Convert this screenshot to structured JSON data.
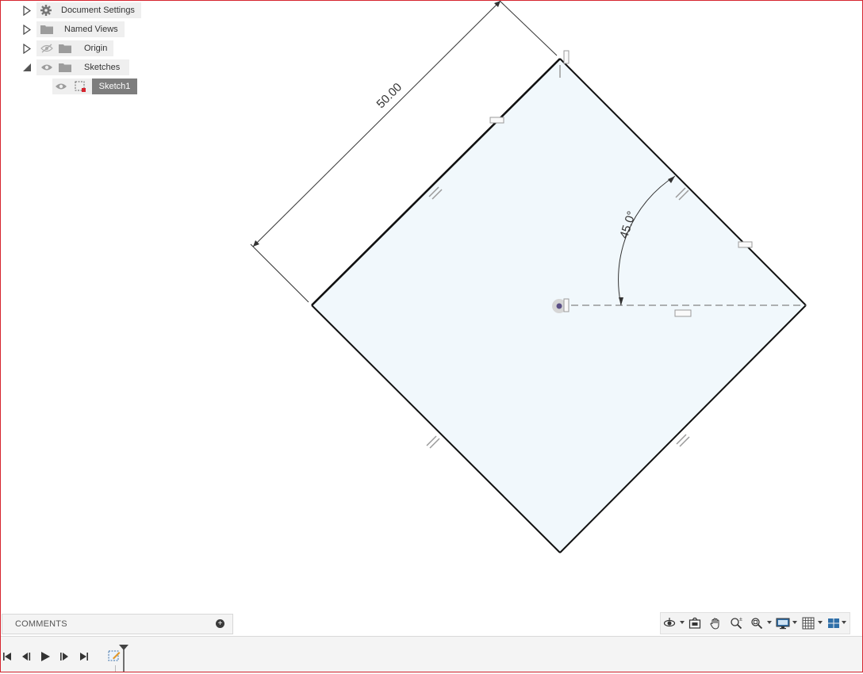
{
  "browser": {
    "items": [
      {
        "label": "Document Settings",
        "icon": "gear-icon",
        "expanded": false
      },
      {
        "label": "Named Views",
        "icon": "folder-icon",
        "expanded": false
      },
      {
        "label": "Origin",
        "icon": "folder-icon",
        "visibility": "hidden-eye-icon",
        "expanded": false
      },
      {
        "label": "Sketches",
        "icon": "folder-icon",
        "visibility": "eye-icon",
        "expanded": true
      }
    ],
    "sketch": {
      "label": "Sketch1",
      "icon": "sketch-icon",
      "visibility": "eye-icon"
    }
  },
  "canvas": {
    "dimension_length": "50.00",
    "dimension_angle": "45.0°",
    "colors": {
      "profile_fill": "#f1f8fc",
      "line": "#111111",
      "dimension": "#333333",
      "constraint": "#9a9a9a"
    }
  },
  "comments": {
    "label": "COMMENTS",
    "add_icon": "plus-circle-icon"
  },
  "navbar": {
    "tools": [
      "orbit-icon",
      "look-at-icon",
      "pan-hand-icon",
      "zoom-icon",
      "fit-icon",
      "display-settings-icon",
      "grid-settings-icon",
      "viewports-icon"
    ]
  },
  "timeline": {
    "controls": [
      "go-to-start-icon",
      "step-back-icon",
      "play-icon",
      "step-forward-icon",
      "go-to-end-icon"
    ],
    "items": [
      "sketch-feature-icon"
    ]
  }
}
